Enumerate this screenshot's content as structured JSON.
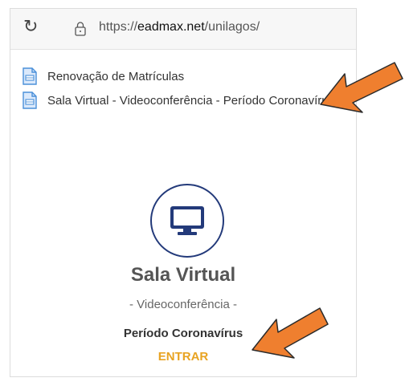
{
  "browser": {
    "url_prefix": "https://",
    "url_domain": "eadmax.net",
    "url_path": "/unilagos/"
  },
  "links": [
    {
      "label": "Renovação de Matrículas",
      "icon": "document-icon"
    },
    {
      "label": "Sala Virtual - Videoconferência - Período Coronavírus",
      "icon": "document-icon"
    }
  ],
  "virtual_room": {
    "icon": "monitor-icon",
    "title": "Sala Virtual",
    "subtitle": "- Videoconferência -",
    "period": "Período Coronavírus",
    "enter_label": "ENTRAR"
  },
  "colors": {
    "accent_orange": "#ef7f2f",
    "enter_text": "#e8a321",
    "icon_navy": "#233a7a",
    "doc_icon_blue": "#4a90d9"
  }
}
